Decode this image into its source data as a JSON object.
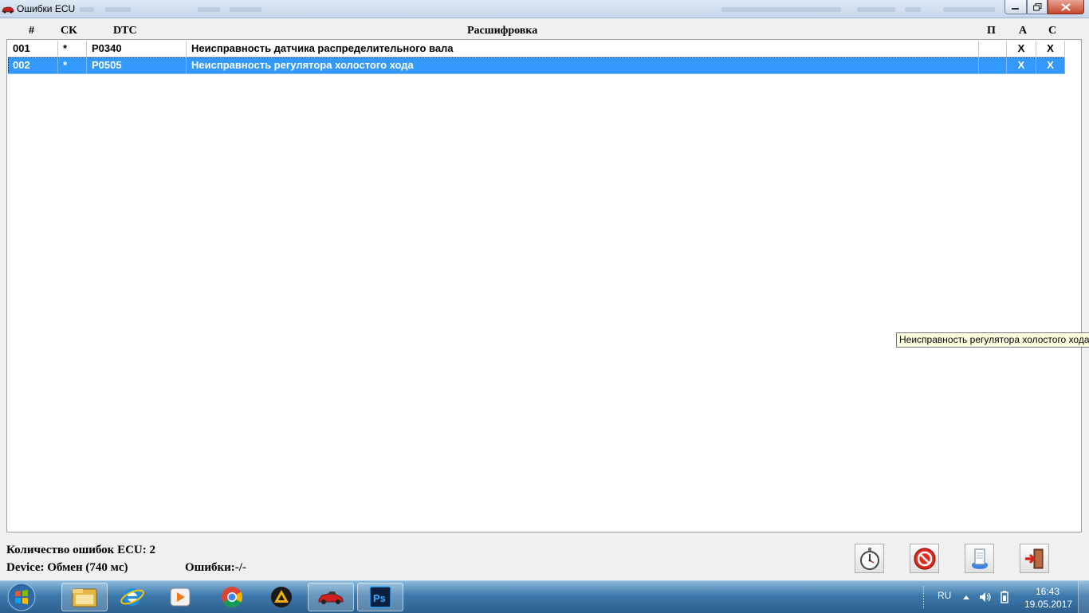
{
  "window": {
    "title": "Ошибки ECU"
  },
  "grid": {
    "columns": {
      "num": "#",
      "ck": "CK",
      "dtc": "DTC",
      "desc": "Расшифровка",
      "p": "П",
      "a": "A",
      "c": "C"
    },
    "rows": [
      {
        "num": "001",
        "ck": "*",
        "dtc": "P0340",
        "desc": "Неисправность датчика распределительного вала",
        "p": "",
        "a": "X",
        "c": "X"
      },
      {
        "num": "002",
        "ck": "*",
        "dtc": "P0505",
        "desc": "Неисправность регулятора холостого хода",
        "p": "",
        "a": "X",
        "c": "X"
      }
    ],
    "selected_row_color": "#3399ff"
  },
  "tooltip": {
    "text": "Неисправность регулятора холостого хода"
  },
  "status": {
    "count": "Количество ошибок ECU: 2",
    "device": "Device: Обмен (740 мс)",
    "errors": "Ошибки:-/-"
  },
  "toolbar": {
    "buttons": [
      {
        "icon": "stopwatch-icon"
      },
      {
        "icon": "no-entry-icon"
      },
      {
        "icon": "document-icon"
      },
      {
        "icon": "exit-door-icon"
      }
    ]
  },
  "taskbar": {
    "apps": [
      "windows-explorer-icon",
      "internet-explorer-icon",
      "media-player-icon",
      "chrome-icon",
      "warning-triangle-app-icon",
      "red-car-app-icon",
      "photoshop-icon"
    ],
    "active_app": "red-car-app-icon",
    "language": "RU",
    "time": "16:43",
    "date": "19.05.2017"
  }
}
